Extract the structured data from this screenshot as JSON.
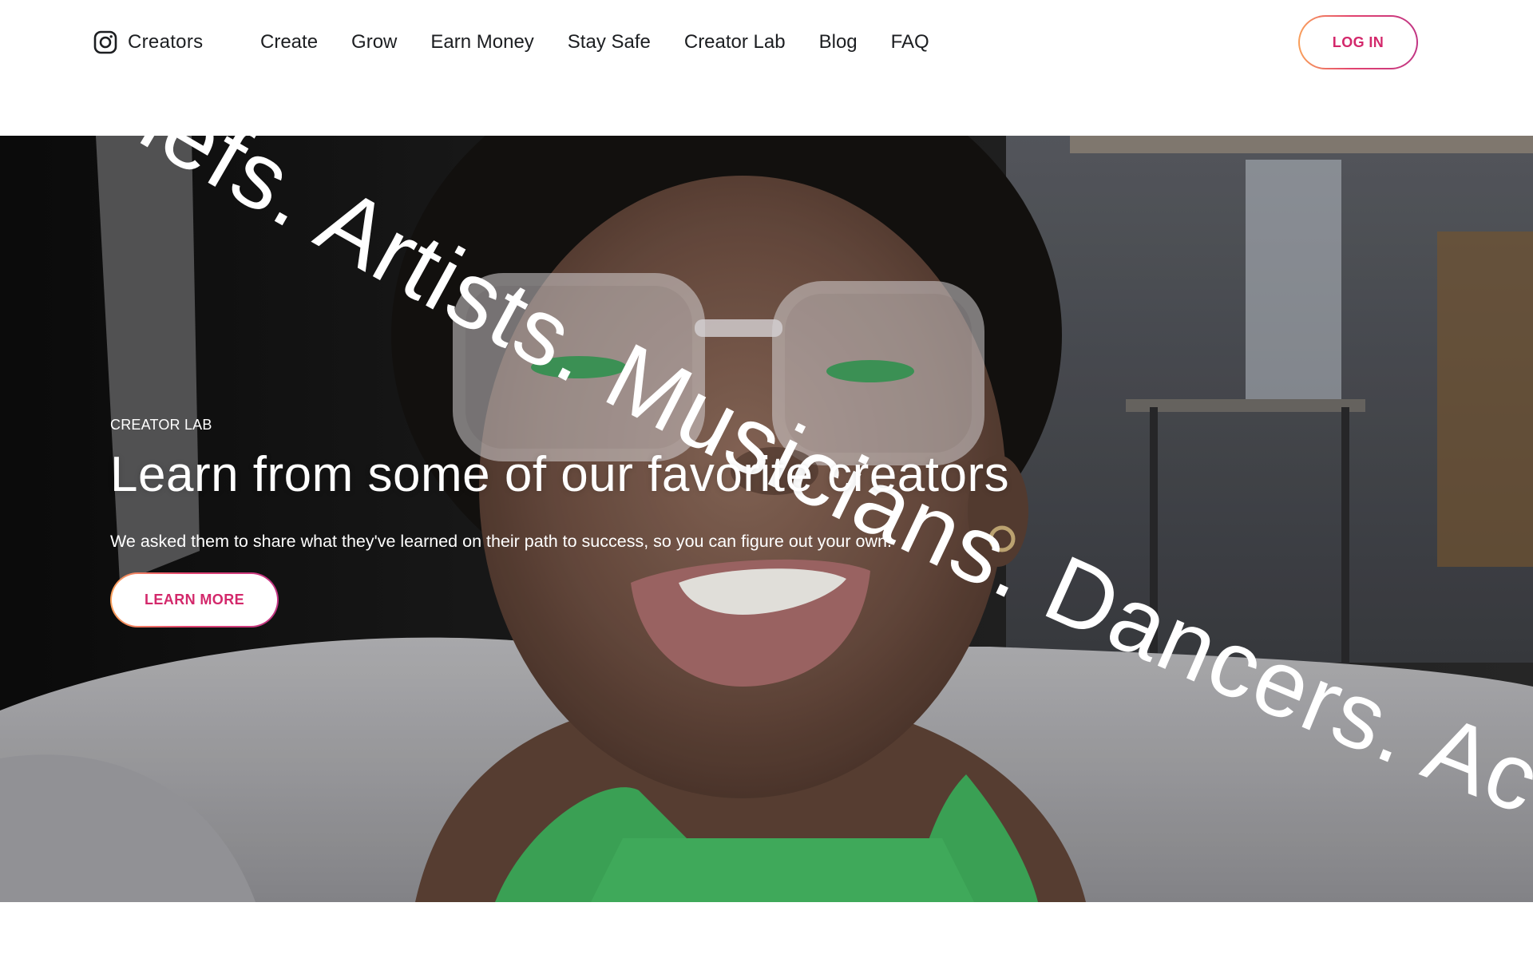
{
  "header": {
    "brand_label": "Creators",
    "nav": [
      {
        "label": "Create"
      },
      {
        "label": "Grow"
      },
      {
        "label": "Earn Money"
      },
      {
        "label": "Stay Safe"
      },
      {
        "label": "Creator Lab"
      },
      {
        "label": "Blog"
      },
      {
        "label": "FAQ"
      }
    ],
    "login_label": "LOG IN"
  },
  "hero": {
    "arc_text": "Chefs. Artists. Musicians. Dancers. Actors.",
    "eyebrow": "CREATOR LAB",
    "title": "Learn from some of our favorite creators",
    "subtitle": "We asked them to share what they've learned on their path to success, so you can figure out your own.",
    "cta_label": "LEARN MORE"
  },
  "colors": {
    "accent": "#d3286b",
    "gradient_start": "#f9a05b",
    "gradient_mid": "#e2436f",
    "gradient_end": "#c13584",
    "text_dark": "#1c1e21",
    "shirt_green": "#3fae5c"
  },
  "icons": {
    "brand": "instagram-icon"
  }
}
